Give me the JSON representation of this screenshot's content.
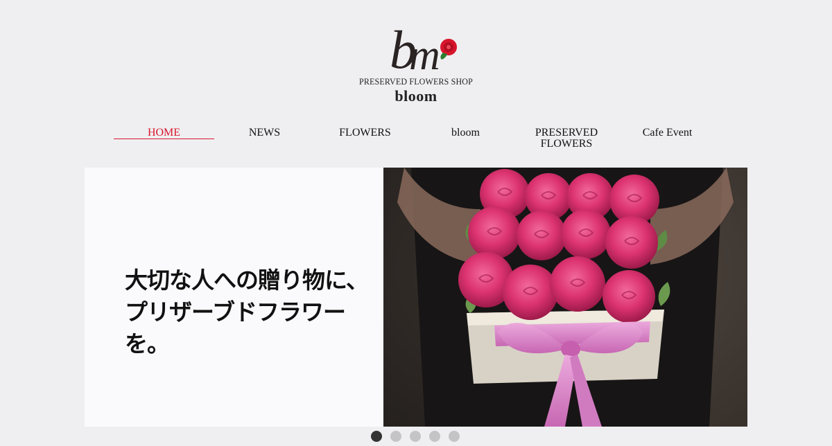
{
  "logo": {
    "monogram": "bm",
    "tagline": "PRESERVED FLOWERS SHOP",
    "name": "bloom"
  },
  "nav": {
    "items": [
      {
        "label": "HOME",
        "active": true
      },
      {
        "label": "NEWS",
        "active": false
      },
      {
        "label": "FLOWERS",
        "active": false
      },
      {
        "label": "bloom",
        "active": false
      },
      {
        "label": "PRESERVED FLOWERS",
        "active": false
      },
      {
        "label": "Cafe Event",
        "active": false
      }
    ]
  },
  "hero": {
    "copy_line1": "大切な人への贈り物に、",
    "copy_line2": "プリザーブドフラワーを。",
    "image": "pink-roses-gift-box-with-ribbon"
  },
  "slider": {
    "slide_count": 5,
    "active_index": 0
  },
  "colors": {
    "accent": "#d8152c",
    "background": "#efeff1",
    "rose": "#e0306f",
    "ribbon": "#dd87c8"
  }
}
